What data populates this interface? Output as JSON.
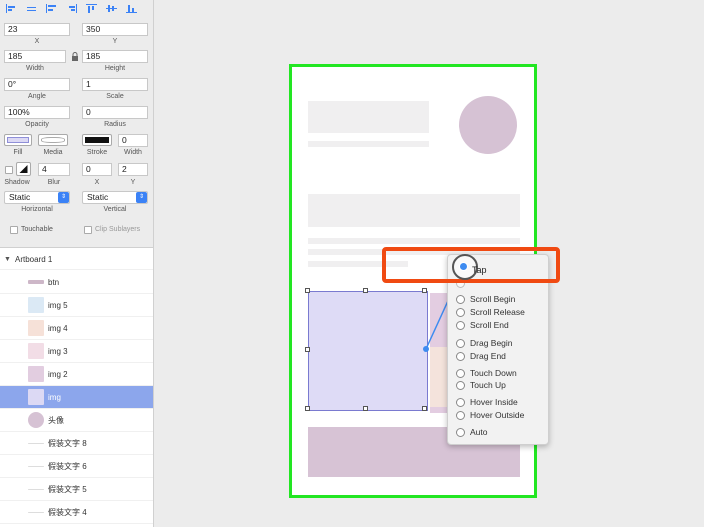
{
  "inspector": {
    "x": {
      "value": "23",
      "label": "X"
    },
    "y": {
      "value": "350",
      "label": "Y"
    },
    "width": {
      "value": "185",
      "label": "Width"
    },
    "height": {
      "value": "185",
      "label": "Height"
    },
    "angle": {
      "value": "0°",
      "label": "Angle"
    },
    "scale": {
      "value": "1",
      "label": "Scale"
    },
    "opacity": {
      "value": "100%",
      "label": "Opacity"
    },
    "radius": {
      "value": "0",
      "label": "Radius"
    },
    "fill_label": "Fill",
    "media_label": "Media",
    "stroke_label": "Stroke",
    "stroke_width": {
      "value": "0",
      "label": "Width"
    },
    "shadow_label": "Shadow",
    "blur": {
      "value": "4",
      "label": "Blur"
    },
    "shadow_x": {
      "value": "0",
      "label": "X"
    },
    "shadow_y": {
      "value": "2",
      "label": "Y"
    },
    "horizontal": {
      "value": "Static",
      "label": "Horizontal"
    },
    "vertical": {
      "value": "Static",
      "label": "Vertical"
    },
    "touchable_label": "Touchable",
    "clip_label": "Clip Sublayers"
  },
  "layers": {
    "group": "Artboard 1",
    "items": [
      {
        "name": "btn",
        "color": "#cdb7c8"
      },
      {
        "name": "img 5",
        "color": "#dbe9f5"
      },
      {
        "name": "img 4",
        "color": "#f6e1d8"
      },
      {
        "name": "img 3",
        "color": "#f2dde6"
      },
      {
        "name": "img 2",
        "color": "#e2cde0"
      },
      {
        "name": "img",
        "color": "#dcd9f4"
      },
      {
        "name": "头像",
        "color": "#d6c2d4"
      },
      {
        "name": "假装文字 8",
        "color": ""
      },
      {
        "name": "假装文字 6",
        "color": ""
      },
      {
        "name": "假装文字 5",
        "color": ""
      },
      {
        "name": "假装文字 4",
        "color": ""
      }
    ]
  },
  "menu": {
    "header": "Tap",
    "items": [
      "Scroll Begin",
      "Scroll Release",
      "Scroll End",
      "Drag Begin",
      "Drag End",
      "Touch Down",
      "Touch Up",
      "Hover Inside",
      "Hover Outside",
      "Auto"
    ]
  },
  "colors": {
    "artboard_border": "#22e622",
    "highlight": "#f04a12",
    "selection": "#8ca6ec",
    "placeholder": "#f0eff0",
    "avatar": "#d6c2d4",
    "image_fill": "#dedbf6",
    "footer_block": "#d7c3d5"
  }
}
